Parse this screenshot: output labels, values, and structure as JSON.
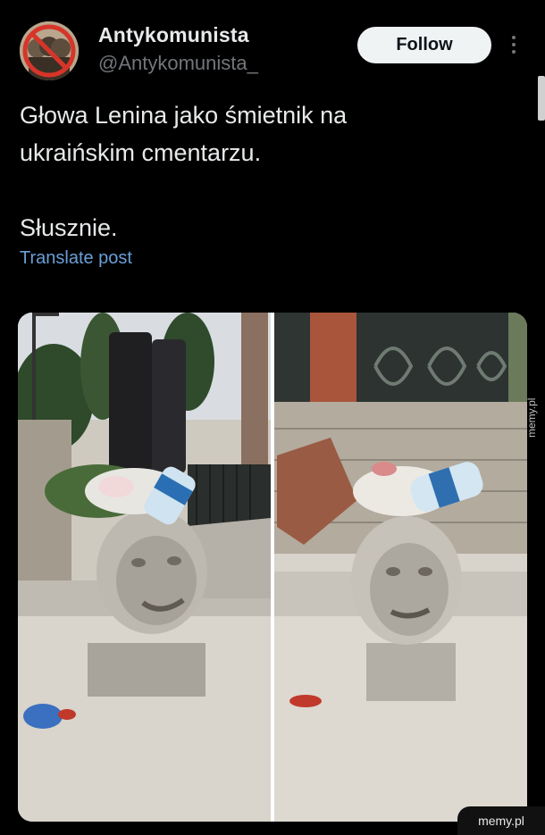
{
  "post": {
    "author_name": "Antykomunista",
    "author_handle": "@Antykomunista_",
    "follow_label": "Follow",
    "text": "Głowa Lenina jako śmietnik na\nukraińskim cmentarzu.\n\nSłusznie.",
    "translate_label": "Translate post"
  },
  "watermark": {
    "side_text": "memy.pl",
    "corner_text": "memy.pl"
  },
  "icons": {
    "avatar": "avatar-icon",
    "more": "more-options-icon"
  },
  "colors": {
    "background": "#000000",
    "text": "#e7e9ea",
    "secondary_text": "#71767b",
    "link": "#6a9fd8",
    "follow_button_bg": "#eff3f4",
    "follow_button_text": "#0f1419"
  }
}
